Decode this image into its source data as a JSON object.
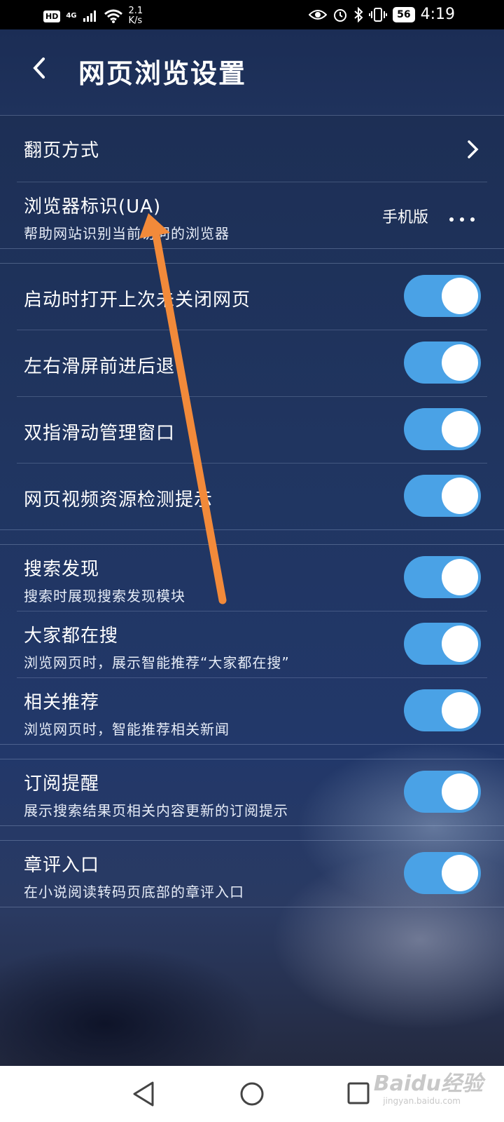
{
  "status": {
    "hd": "HD",
    "network": "4G",
    "speed_value": "2.1",
    "speed_unit": "K/s",
    "battery": "56",
    "time": "4:19"
  },
  "header": {
    "title": "网页浏览设置"
  },
  "page_turn": {
    "label": "翻页方式"
  },
  "ua": {
    "label": "浏览器标识(UA)",
    "sub": "帮助网站识别当前访问的浏览器",
    "value": "手机版"
  },
  "toggles_group1": [
    {
      "label": "启动时打开上次未关闭网页",
      "on": true
    },
    {
      "label": "左右滑屏前进后退",
      "on": true
    },
    {
      "label": "双指滑动管理窗口",
      "on": true
    },
    {
      "label": "网页视频资源检测提示",
      "on": true
    }
  ],
  "toggles_group2": [
    {
      "label": "搜索发现",
      "sub": "搜索时展现搜索发现模块",
      "on": true
    },
    {
      "label": "大家都在搜",
      "sub": "浏览网页时，展示智能推荐“大家都在搜”",
      "on": true
    },
    {
      "label": "相关推荐",
      "sub": "浏览网页时，智能推荐相关新闻",
      "on": true
    }
  ],
  "subscription": {
    "label": "订阅提醒",
    "sub": "展示搜索结果页相关内容更新的订阅提示",
    "on": true
  },
  "chapter_review": {
    "label": "章评入口",
    "sub": "在小说阅读转码页底部的章评入口",
    "on": true
  },
  "watermark": {
    "brand": "Baidu经验",
    "url": "jingyan.baidu.com"
  },
  "colors": {
    "toggle_on": "#4aa2e6",
    "arrow": "#f28a3a",
    "background": "#1e2f55"
  }
}
